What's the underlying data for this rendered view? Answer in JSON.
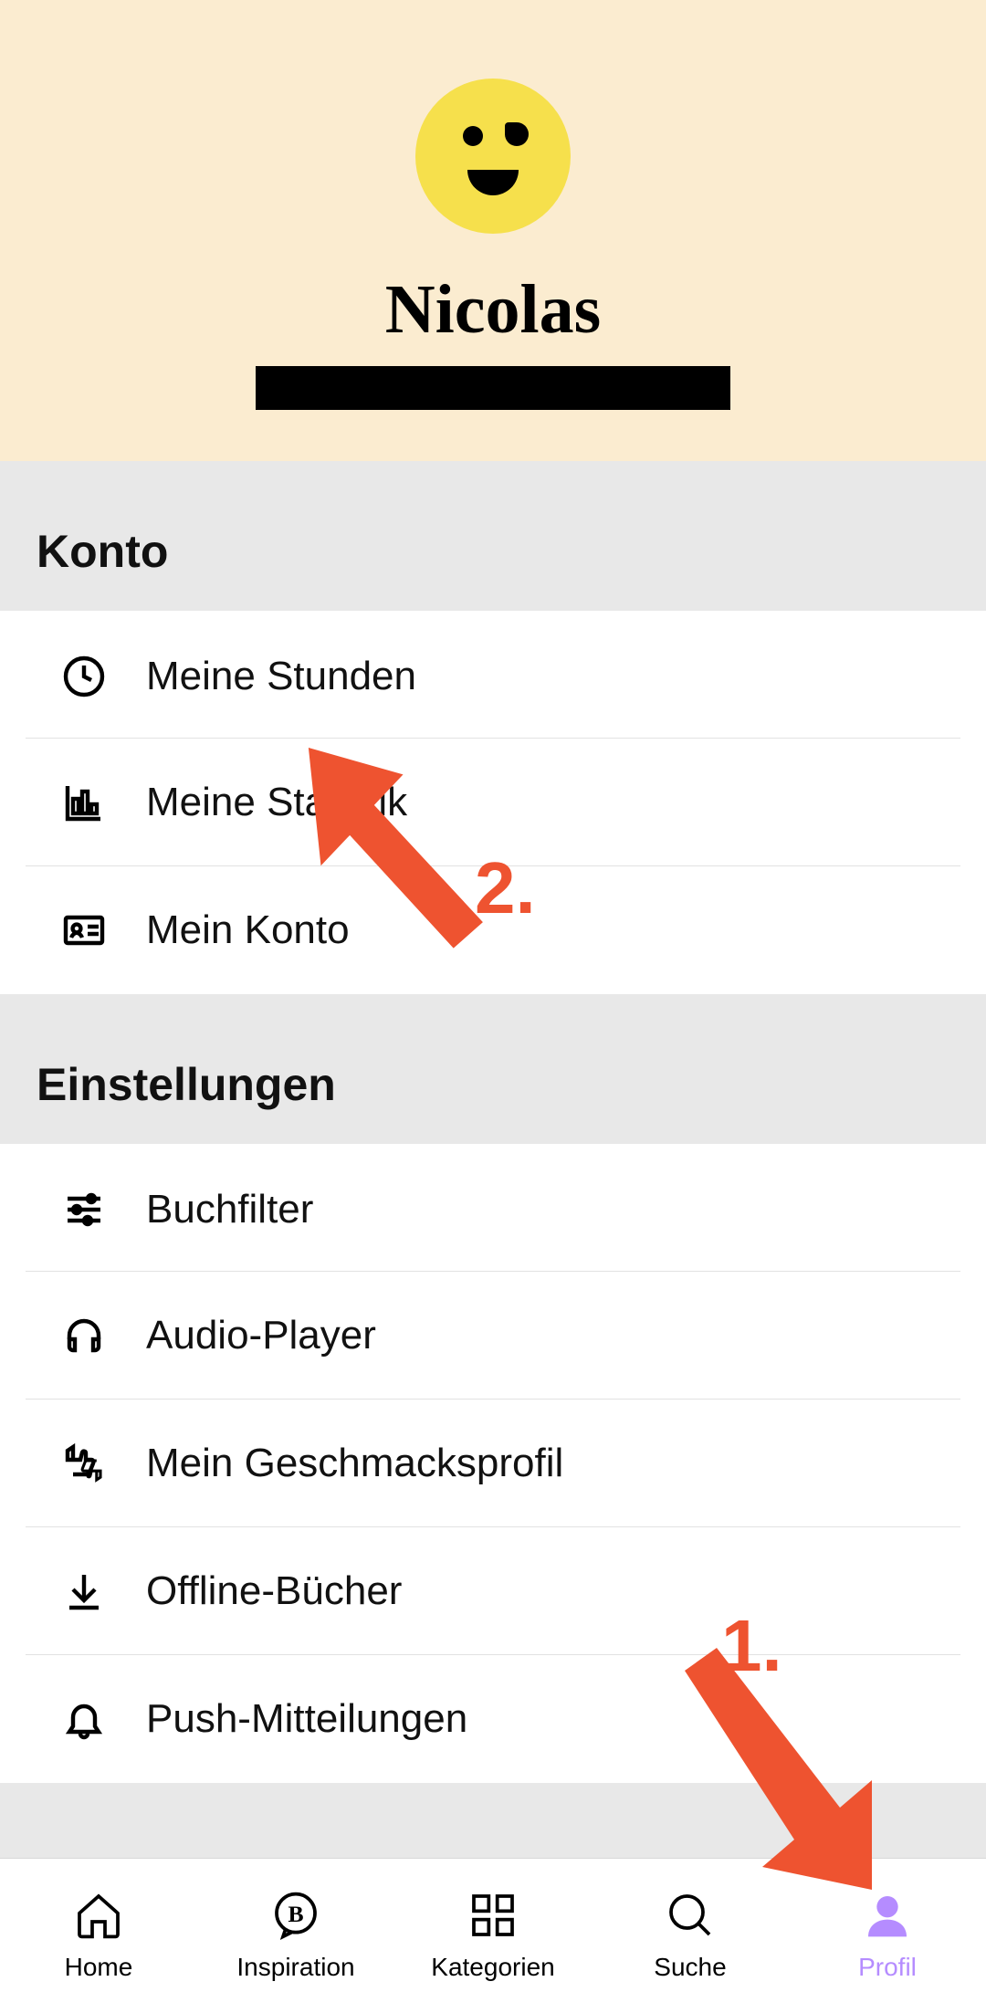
{
  "profile": {
    "name": "Nicolas"
  },
  "sections": {
    "account": {
      "title": "Konto",
      "items": [
        {
          "label": "Meine Stunden"
        },
        {
          "label": "Meine Statistik"
        },
        {
          "label": "Mein Konto"
        }
      ]
    },
    "settings": {
      "title": "Einstellungen",
      "items": [
        {
          "label": "Buchfilter"
        },
        {
          "label": "Audio-Player"
        },
        {
          "label": "Mein Geschmacksprofil"
        },
        {
          "label": "Offline-Bücher"
        },
        {
          "label": "Push-Mitteilungen"
        }
      ]
    }
  },
  "nav": {
    "home": "Home",
    "inspiration": "Inspiration",
    "categories": "Kategorien",
    "search": "Suche",
    "profile": "Profil"
  },
  "annotations": {
    "step1": "1.",
    "step2": "2."
  }
}
